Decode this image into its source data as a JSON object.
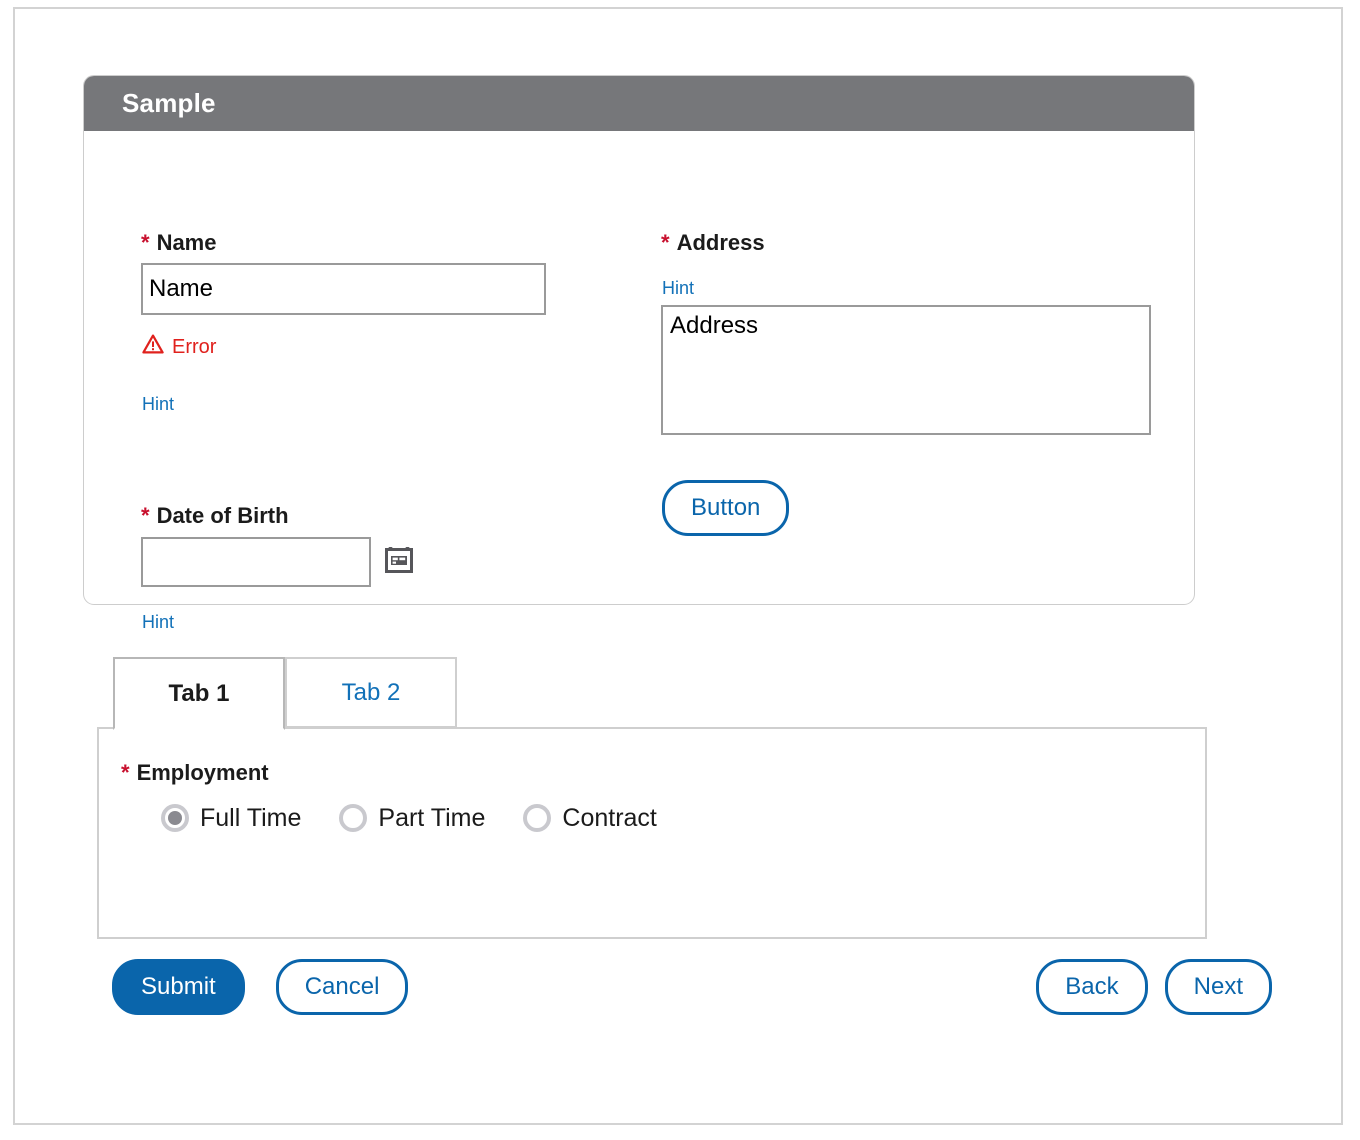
{
  "card": {
    "title": "Sample",
    "name_field": {
      "label": "Name",
      "required_marker": "*",
      "value": "Name",
      "placeholder": "Name",
      "error_text": "Error",
      "error_icon": "warning-triangle-icon",
      "hint_text": "Hint"
    },
    "address_field": {
      "label": "Address",
      "required_marker": "*",
      "hint_text": "Hint",
      "value": "Address",
      "placeholder": "Address"
    },
    "dob_field": {
      "label": "Date of Birth",
      "required_marker": "*",
      "value": "",
      "placeholder": "",
      "hint_text": "Hint",
      "calendar_icon": "calendar-icon"
    },
    "plain_button_label": "Button"
  },
  "tabs": [
    {
      "label": "Tab 1",
      "active": true
    },
    {
      "label": "Tab 2",
      "active": false
    }
  ],
  "tab_panel": {
    "employment": {
      "label": "Employment",
      "required_marker": "*",
      "options": [
        {
          "label": "Full Time",
          "checked": true
        },
        {
          "label": "Part Time",
          "checked": false
        },
        {
          "label": "Contract",
          "checked": false
        }
      ]
    }
  },
  "footer": {
    "submit_label": "Submit",
    "cancel_label": "Cancel",
    "back_label": "Back",
    "next_label": "Next"
  },
  "colors": {
    "header_gray": "#76777a",
    "accent_blue": "#0a65ab",
    "hint_blue": "#1271b8",
    "required_red": "#c8102e",
    "error_red": "#e0211d",
    "border_gray": "#cdcdcd",
    "input_border": "#9a9a9a",
    "radio_ring": "#c9c9ce",
    "radio_dot": "#8a8a90"
  }
}
